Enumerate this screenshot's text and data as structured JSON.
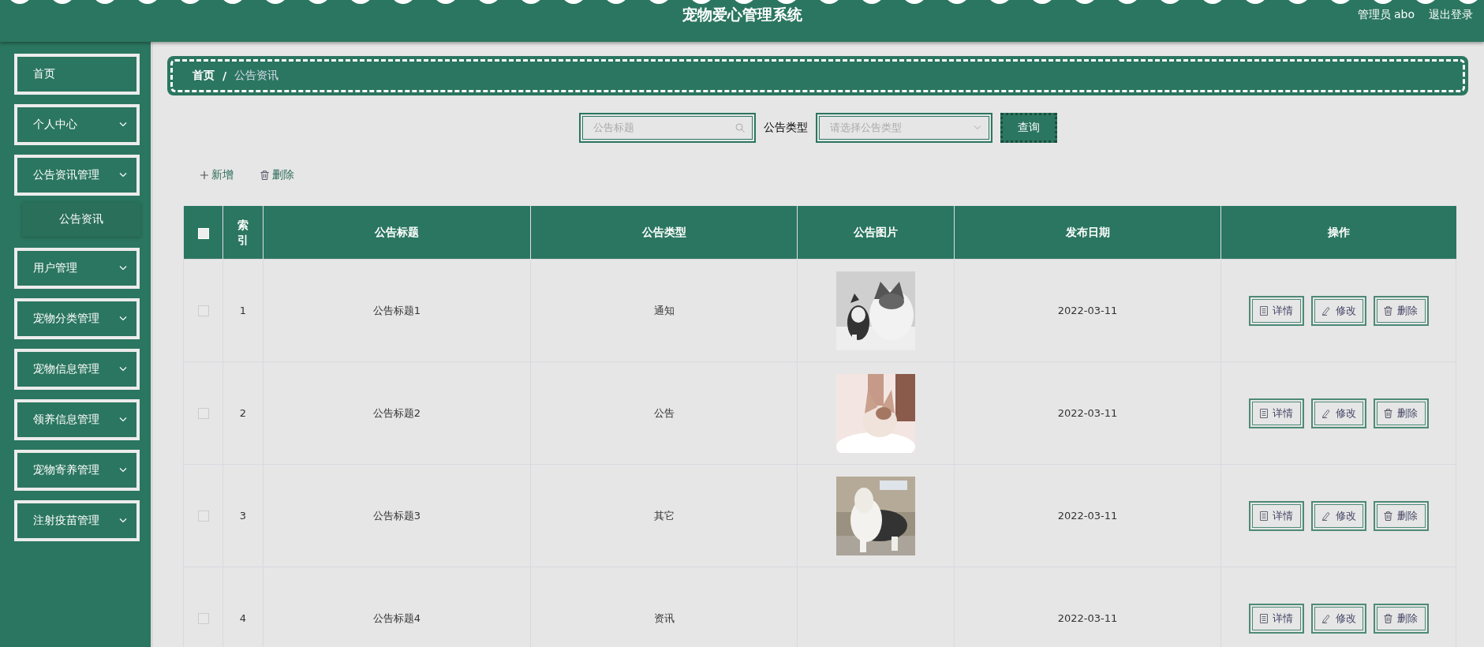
{
  "header": {
    "title": "宠物爱心管理系统",
    "user_role": "管理员",
    "user_name": "abo",
    "logout": "退出登录"
  },
  "sidebar": {
    "items": [
      {
        "label": "首页",
        "kind": "link"
      },
      {
        "label": "个人中心",
        "kind": "group"
      },
      {
        "label": "公告资讯管理",
        "kind": "group",
        "children": [
          {
            "label": "公告资讯"
          }
        ]
      },
      {
        "label": "用户管理",
        "kind": "group"
      },
      {
        "label": "宠物分类管理",
        "kind": "group"
      },
      {
        "label": "宠物信息管理",
        "kind": "group"
      },
      {
        "label": "领养信息管理",
        "kind": "group"
      },
      {
        "label": "宠物寄养管理",
        "kind": "group"
      },
      {
        "label": "注射疫苗管理",
        "kind": "group"
      }
    ]
  },
  "breadcrumb": {
    "items": [
      "首页",
      "公告资讯"
    ],
    "separator": "/"
  },
  "search": {
    "title_placeholder": "公告标题",
    "type_label": "公告类型",
    "type_placeholder": "请选择公告类型",
    "button": "查询"
  },
  "toolbar": [
    {
      "label": "新增",
      "kind": "add"
    },
    {
      "label": "删除",
      "kind": "delete"
    }
  ],
  "table": {
    "select_all": {
      "checked": false
    },
    "columns": [
      "索引",
      "公告标题",
      "公告类型",
      "公告图片",
      "发布日期",
      "操作"
    ],
    "rows": [
      {
        "checked": false,
        "index": "1",
        "title": "公告标题1",
        "type": "通知",
        "image": {
          "kind": "picture"
        },
        "date": "2022-03-11",
        "actions": [
          {
            "label": "详情",
            "kind": "detail"
          },
          {
            "label": "修改",
            "kind": "edit"
          },
          {
            "label": "删除",
            "kind": "delete"
          }
        ]
      },
      {
        "checked": false,
        "index": "2",
        "title": "公告标题2",
        "type": "公告",
        "image": {
          "kind": "picture"
        },
        "date": "2022-03-11",
        "actions": [
          {
            "label": "详情",
            "kind": "detail"
          },
          {
            "label": "修改",
            "kind": "edit"
          },
          {
            "label": "删除",
            "kind": "delete"
          }
        ]
      },
      {
        "checked": false,
        "index": "3",
        "title": "公告标题3",
        "type": "其它",
        "image": {
          "kind": "picture"
        },
        "date": "2022-03-11",
        "actions": [
          {
            "label": "详情",
            "kind": "detail"
          },
          {
            "label": "修改",
            "kind": "edit"
          },
          {
            "label": "删除",
            "kind": "delete"
          }
        ]
      },
      {
        "checked": false,
        "index": "4",
        "title": "公告标题4",
        "type": "资讯",
        "date": "2022-03-11",
        "actions": [
          {
            "label": "详情",
            "kind": "detail"
          },
          {
            "label": "修改",
            "kind": "edit"
          },
          {
            "label": "删除",
            "kind": "delete"
          }
        ]
      }
    ]
  }
}
